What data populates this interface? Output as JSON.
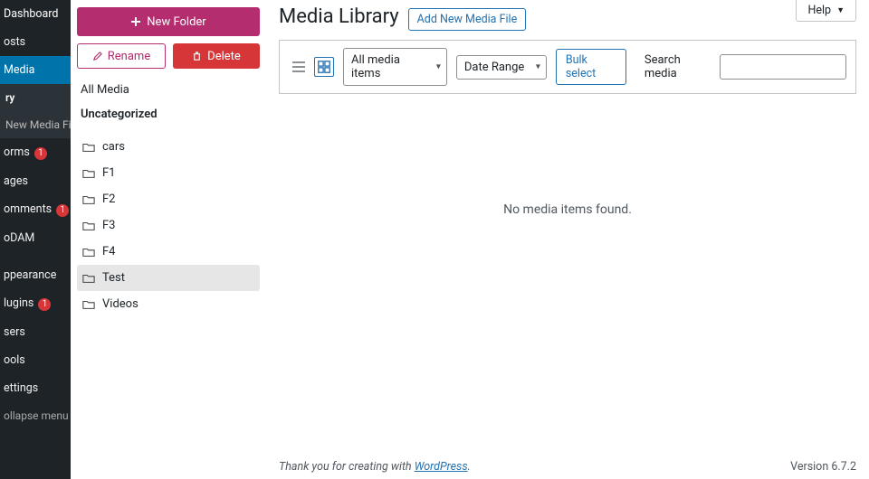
{
  "help_label": "Help",
  "sidebar": {
    "dashboard": "Dashboard",
    "posts": "osts",
    "media": "Media",
    "library": "ry",
    "add_new": "New Media File",
    "forms": "orms",
    "forms_badge": "1",
    "pages": "ages",
    "comments": "omments",
    "comments_badge": "1",
    "godam": "oDAM",
    "appearance": "ppearance",
    "plugins": "lugins",
    "plugins_badge": "1",
    "users": "sers",
    "tools": "ools",
    "settings": "ettings",
    "collapse": "ollapse menu"
  },
  "folder_panel": {
    "new_folder": "New Folder",
    "rename": "Rename",
    "delete": "Delete",
    "all_media": "All Media",
    "uncategorized": "Uncategorized",
    "folders": [
      "cars",
      "F1",
      "F2",
      "F3",
      "F4",
      "Test",
      "Videos"
    ],
    "selected_index": 5
  },
  "header": {
    "title": "Media Library",
    "add_new": "Add New Media File"
  },
  "toolbar": {
    "filter_media": "All media items",
    "filter_date": "Date Range",
    "bulk_select": "Bulk select",
    "search_label": "Search media"
  },
  "content": {
    "empty": "No media items found."
  },
  "footer": {
    "thanks_prefix": "Thank you for creating with ",
    "wp": "WordPress",
    "version": "Version 6.7.2"
  }
}
